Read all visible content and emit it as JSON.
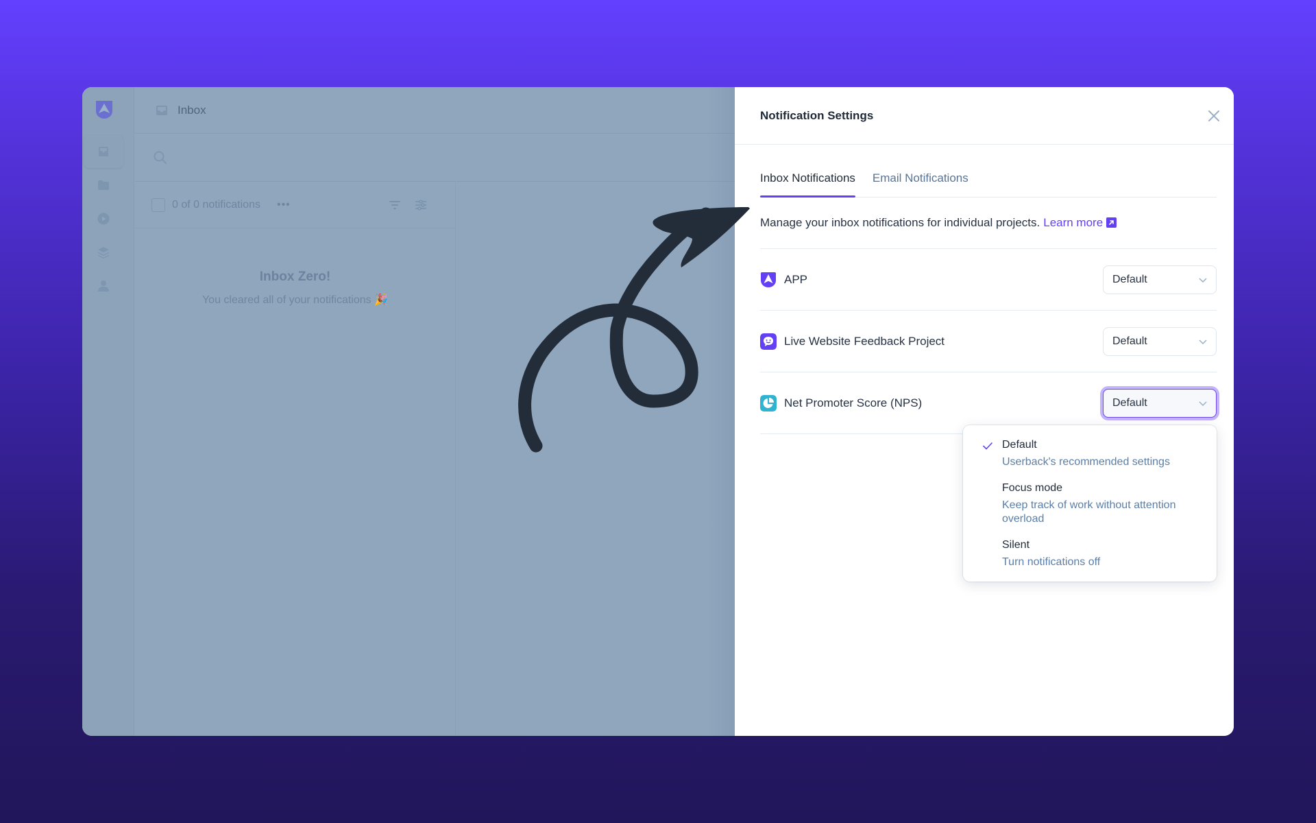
{
  "app": {
    "header_title": "Inbox",
    "sidebar_items": [
      "inbox",
      "projects",
      "recordings",
      "layers",
      "account"
    ],
    "search_placeholder": "",
    "toolbar": {
      "count_text": "0 of 0 notifications",
      "more_label": "•••"
    },
    "empty_state": {
      "title": "Inbox Zero!",
      "subtitle": "You cleared all of your notifications 🎉"
    }
  },
  "panel": {
    "title": "Notification Settings",
    "tabs": [
      {
        "label": "Inbox Notifications",
        "active": true
      },
      {
        "label": "Email Notifications",
        "active": false
      }
    ],
    "description": "Manage your inbox notifications for individual projects.",
    "learn_more": "Learn more",
    "projects": [
      {
        "name": "APP",
        "icon": "app-logo-icon",
        "color": "#6440f5",
        "setting": "Default"
      },
      {
        "name": "Live Website Feedback Project",
        "icon": "chat-bubble-icon",
        "color": "#6440f5",
        "setting": "Default"
      },
      {
        "name": "Net Promoter Score (NPS)",
        "icon": "pie-chart-icon",
        "color": "#2fb3d1",
        "setting": "Default"
      }
    ],
    "dropdown": {
      "selected": "Default",
      "options": [
        {
          "label": "Default",
          "description": "Userback's recommended settings"
        },
        {
          "label": "Focus mode",
          "description": "Keep track of work without attention overload"
        },
        {
          "label": "Silent",
          "description": "Turn notifications off"
        }
      ]
    }
  },
  "colors": {
    "accent": "#6440f5",
    "background_top": "#6340fe",
    "background_bottom": "#21165a",
    "overlay": "#8fa6bd",
    "annotation_arrow": "#232d3a"
  }
}
